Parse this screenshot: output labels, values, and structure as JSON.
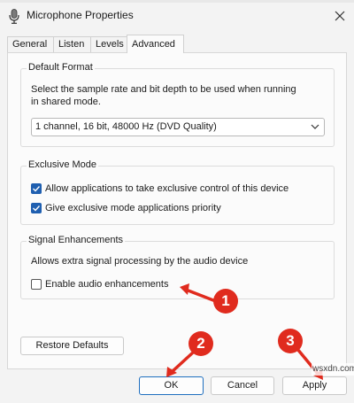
{
  "window": {
    "title": "Microphone Properties"
  },
  "tabs": [
    {
      "label": "General"
    },
    {
      "label": "Listen"
    },
    {
      "label": "Levels"
    },
    {
      "label": "Advanced"
    }
  ],
  "default_format": {
    "legend": "Default Format",
    "description_line1": "Select the sample rate and bit depth to be used when running",
    "description_line2": "in shared mode.",
    "selected": "1 channel, 16 bit, 48000 Hz (DVD Quality)"
  },
  "exclusive_mode": {
    "legend": "Exclusive Mode",
    "options": [
      {
        "label": "Allow applications to take exclusive control of this device",
        "checked": true
      },
      {
        "label": "Give exclusive mode applications priority",
        "checked": true
      }
    ]
  },
  "signal_enhancements": {
    "legend": "Signal Enhancements",
    "description": "Allows extra signal processing by the audio device",
    "option": {
      "label": "Enable audio enhancements",
      "checked": false
    }
  },
  "buttons": {
    "restore_defaults": "Restore Defaults",
    "ok": "OK",
    "cancel": "Cancel",
    "apply": "Apply"
  },
  "annotations": {
    "callout_1": "1",
    "callout_2": "2",
    "callout_3": "3",
    "color": "#e02b1e"
  },
  "watermark": "wsxdn.com"
}
